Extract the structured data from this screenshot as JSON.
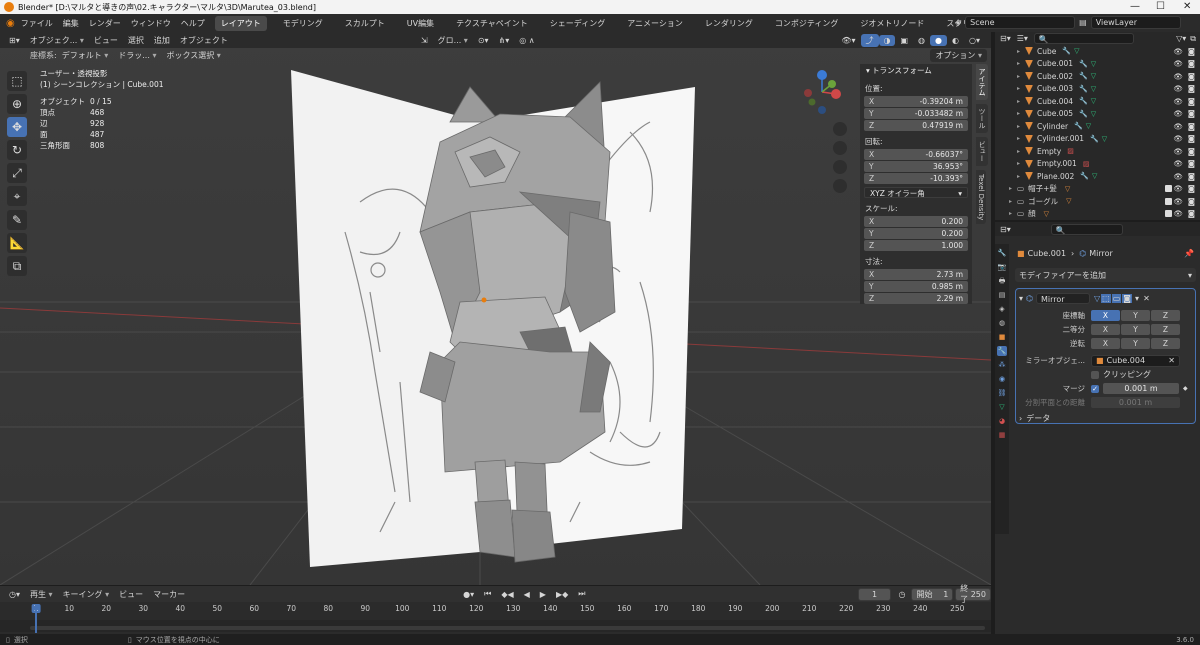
{
  "window": {
    "title": "Blender* [D:\\マルタと導きの声\\02.キャラクター\\マルタ\\3D\\Marutea_03.blend]"
  },
  "menu": {
    "items": [
      "ファイル",
      "編集",
      "レンダー",
      "ウィンドウ",
      "ヘルプ"
    ]
  },
  "workspaces": [
    "レイアウト",
    "モデリング",
    "スカルプト",
    "UV編集",
    "テクスチャペイント",
    "シェーディング",
    "アニメーション",
    "レンダリング",
    "コンポジティング",
    "ジオメトリノード",
    "スクリプト作成"
  ],
  "scene": {
    "name": "Scene",
    "view_layer": "ViewLayer"
  },
  "viewport_header": {
    "mode": "オブジェク...",
    "menus": [
      "ビュー",
      "選択",
      "追加",
      "オブジェクト"
    ],
    "transform_orient": "グロ...",
    "coord_label": "座標系:",
    "coord_value": "デフォルト",
    "drag_label": "ドラッ...",
    "select_mode": "ボックス選択",
    "options": "オプション"
  },
  "viewport_stats": {
    "view_name": "ユーザー・透視投影",
    "collection": "(1) シーンコレクション | Cube.001",
    "rows": [
      {
        "k": "オブジェクト",
        "v": "0 / 15"
      },
      {
        "k": "頂点",
        "v": "468"
      },
      {
        "k": "辺",
        "v": "928"
      },
      {
        "k": "面",
        "v": "487"
      },
      {
        "k": "三角形面",
        "v": "808"
      }
    ]
  },
  "npanel": {
    "header": "トランスフォーム",
    "location_label": "位置:",
    "location": [
      {
        "k": "X",
        "v": "-0.39204 m"
      },
      {
        "k": "Y",
        "v": "-0.033482 m"
      },
      {
        "k": "Z",
        "v": "0.47919 m"
      }
    ],
    "rotation_label": "回転:",
    "rotation": [
      {
        "k": "X",
        "v": "-0.66037°"
      },
      {
        "k": "Y",
        "v": "36.953°"
      },
      {
        "k": "Z",
        "v": "-10.393°"
      }
    ],
    "rotation_mode": "XYZ オイラー角",
    "scale_label": "スケール:",
    "scale": [
      {
        "k": "X",
        "v": "0.200"
      },
      {
        "k": "Y",
        "v": "0.200"
      },
      {
        "k": "Z",
        "v": "1.000"
      }
    ],
    "dimensions_label": "寸法:",
    "dimensions": [
      {
        "k": "X",
        "v": "2.73 m"
      },
      {
        "k": "Y",
        "v": "0.985 m"
      },
      {
        "k": "Z",
        "v": "2.29 m"
      }
    ],
    "tabs": [
      "アイテム",
      "ツール",
      "ビュー",
      "Texel Density"
    ]
  },
  "outliner": {
    "items": [
      "Cube",
      "Cube.001",
      "Cube.002",
      "Cube.003",
      "Cube.004",
      "Cube.005",
      "Cylinder",
      "Cylinder.001",
      "Empty",
      "Empty.001",
      "Plane.002"
    ],
    "collections": [
      "帽子+髪",
      "ゴーグル",
      "顔"
    ]
  },
  "properties": {
    "breadcrumb_object": "Cube.001",
    "breadcrumb_modifier": "Mirror",
    "add_modifier": "モディファイアーを追加",
    "modifier_name": "Mirror",
    "axis_label": "座標軸",
    "bisect_label": "二等分",
    "flip_label": "逆転",
    "axes": [
      "X",
      "Y",
      "Z"
    ],
    "mirror_object_label": "ミラーオブジェ...",
    "mirror_object": "Cube.004",
    "clipping_label": "クリッピング",
    "merge_label": "マージ",
    "merge_value": "0.001 m",
    "bisect_distance_label": "分割平面との距離",
    "bisect_distance_value": "0.001 m",
    "data_label": "データ"
  },
  "timeline": {
    "menus": [
      "再生",
      "キーイング",
      "ビュー",
      "マーカー"
    ],
    "current_frame": "1",
    "start_label": "開始",
    "start": "1",
    "end_label": "終了",
    "end": "250",
    "ticks": [
      "1",
      "10",
      "20",
      "30",
      "40",
      "50",
      "60",
      "70",
      "80",
      "90",
      "100",
      "110",
      "120",
      "130",
      "140",
      "150",
      "160",
      "170",
      "180",
      "190",
      "200",
      "210",
      "220",
      "230",
      "240",
      "250"
    ]
  },
  "status": {
    "select": "選択",
    "center": "マウス位置を視点の中心に",
    "version": "3.6.0"
  },
  "colors": {
    "accent": "#4772b3",
    "orange": "#e87d0d",
    "mesh_green": "#2ec27e"
  }
}
